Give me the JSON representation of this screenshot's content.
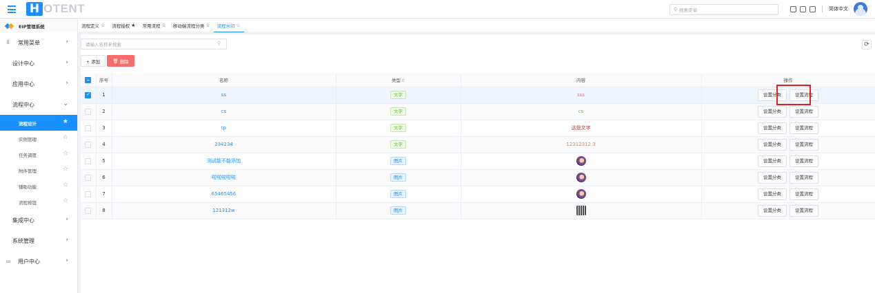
{
  "header": {
    "logo_text": "OTENT",
    "logo_letter": "H",
    "search_placeholder": "搜索菜单",
    "language": "简体中文"
  },
  "sidebar": {
    "system_name": "EIP管理系统",
    "groups": [
      {
        "label": "常用菜单"
      },
      {
        "label": "设计中心"
      },
      {
        "label": "应用中心"
      },
      {
        "label": "流程中心"
      },
      {
        "label": "集成中心"
      },
      {
        "label": "系统管理"
      },
      {
        "label": "用户中心"
      }
    ],
    "sub_items": [
      {
        "label": "流程设计"
      },
      {
        "label": "实例管理"
      },
      {
        "label": "任务调度"
      },
      {
        "label": "附件管理"
      },
      {
        "label": "辅助功能"
      },
      {
        "label": "流程按钮"
      }
    ]
  },
  "tabs": [
    {
      "label": "流程定义",
      "star": "☆"
    },
    {
      "label": "流程授权",
      "star": "★"
    },
    {
      "label": "常用流程",
      "star": "☆"
    },
    {
      "label": "移动端流程分类",
      "star": "☆"
    },
    {
      "label": "流程水印",
      "star": "☆"
    }
  ],
  "toolbar": {
    "search_placeholder": "请输入名称来搜索",
    "add_label": "+ 添加",
    "delete_label": "删除"
  },
  "table": {
    "columns": [
      "序号",
      "名称",
      "类型",
      "内容",
      "操作"
    ],
    "rows": [
      {
        "index": "1",
        "name": "ss",
        "type": "文字",
        "content": "sss",
        "content_color": "#f56c6c"
      },
      {
        "index": "2",
        "name": "cs",
        "type": "文字",
        "content": "cs",
        "content_color": "#67c23a"
      },
      {
        "index": "3",
        "name": "tp",
        "type": "文字",
        "content": "这是文字",
        "content_color": "#c0392b"
      },
      {
        "index": "4",
        "name": "234234",
        "type": "文字",
        "content": "12312312 3",
        "content_color": "#f0804a"
      },
      {
        "index": "5",
        "name": "测试能不能添加",
        "type": "图片",
        "content": ""
      },
      {
        "index": "6",
        "name": "啦啦啦啦啦",
        "type": "图片",
        "content": ""
      },
      {
        "index": "7",
        "name": "65465456",
        "type": "图片",
        "content": ""
      },
      {
        "index": "8",
        "name": "121312w",
        "type": "图片",
        "content": ""
      }
    ],
    "action_category": "设置分类",
    "action_flow": "设置流程"
  },
  "colors": {
    "primary": "#1890ff",
    "danger": "#f56c6c",
    "highlight": "#e31c1c"
  }
}
